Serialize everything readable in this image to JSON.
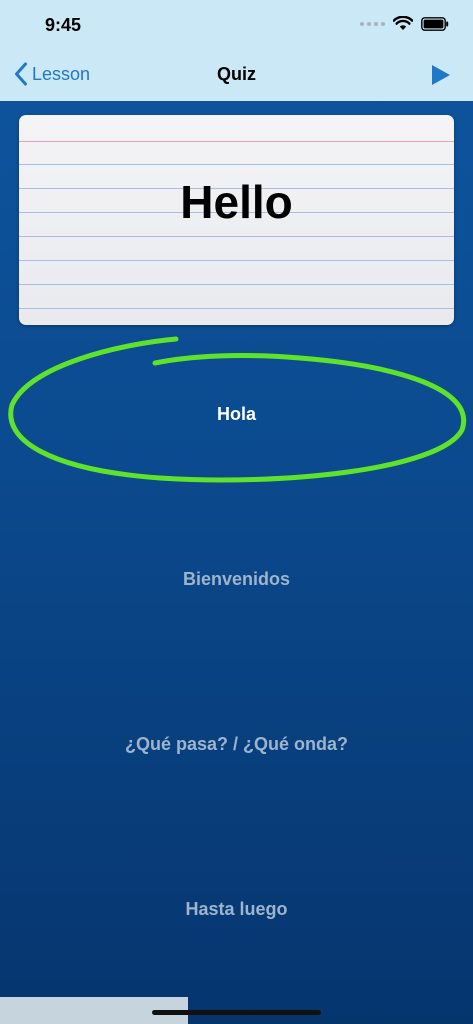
{
  "status_bar": {
    "time": "9:45"
  },
  "nav": {
    "back_label": "Lesson",
    "title": "Quiz"
  },
  "card": {
    "word": "Hello"
  },
  "answers": [
    {
      "label": "Hola"
    },
    {
      "label": "Bienvenidos"
    },
    {
      "label": "¿Qué pasa? / ¿Qué onda?"
    },
    {
      "label": "Hasta luego"
    }
  ],
  "colors": {
    "nav_background": "#cbe8f6",
    "accent": "#1f78c8",
    "highlight_circle": "#5ee32a",
    "background_top": "#0e56a0",
    "background_bottom": "#06356e"
  },
  "icons": [
    "wifi-icon",
    "battery-icon",
    "chevron-left-icon",
    "play-icon"
  ]
}
